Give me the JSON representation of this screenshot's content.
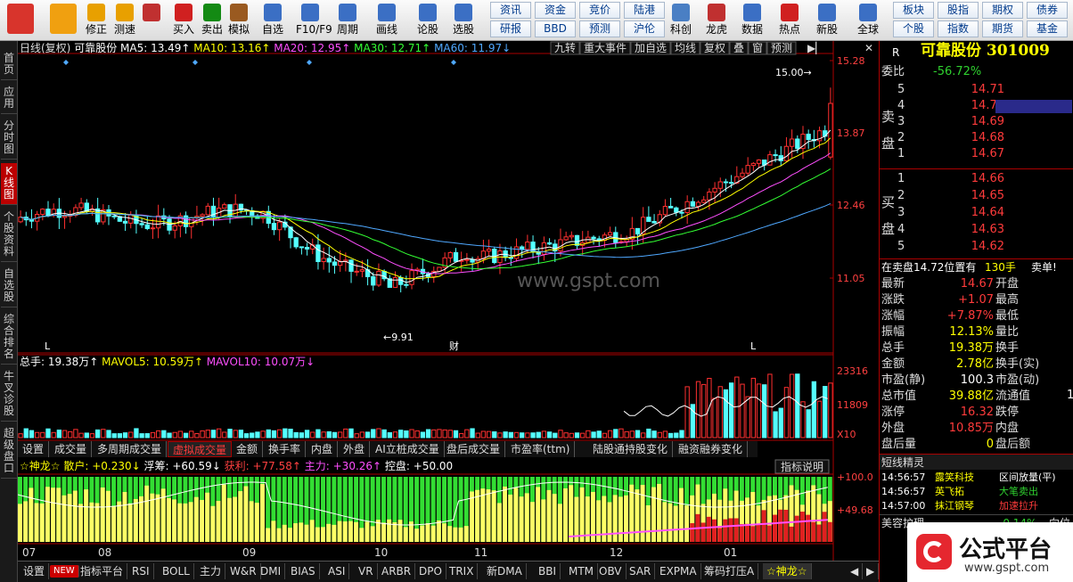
{
  "toolbar": {
    "big": [
      {
        "label": "",
        "icon": "grid-icon",
        "color": "#d8342c"
      },
      {
        "label": "",
        "icon": "back-arrow-icon",
        "color": "#f0a010"
      },
      {
        "label": "修正",
        "icon": "up-arrow-icon",
        "color": "#e8a000"
      },
      {
        "label": "测速",
        "icon": "speed-icon",
        "color": "#e8a000"
      },
      {
        "label": "",
        "icon": "clock-icon",
        "color": "#c03030"
      },
      {
        "label": "买入",
        "icon": "buy-icon",
        "color": "#d02020"
      },
      {
        "label": "卖出",
        "icon": "sell-icon",
        "color": "#138a13"
      },
      {
        "label": "模拟",
        "icon": "hammer-icon",
        "color": "#9a5a20"
      },
      {
        "label": "自选",
        "icon": "star-icon",
        "color": "#3b6fc4"
      },
      {
        "label": "F10/F9",
        "icon": "f10-icon",
        "color": "#3b6fc4"
      },
      {
        "label": "周期",
        "icon": "cycle-icon",
        "color": "#3b6fc4"
      },
      {
        "label": "画线",
        "icon": "pencil-icon",
        "color": "#3b6fc4"
      },
      {
        "label": "论股",
        "icon": "discuss-icon",
        "color": "#3b6fc4"
      },
      {
        "label": "选股",
        "icon": "pick-icon",
        "color": "#3b6fc4"
      },
      {
        "label": "科创",
        "icon": "kechuang-icon",
        "color": "#4a7fc4"
      },
      {
        "label": "龙虎",
        "icon": "dragon-icon",
        "color": "#c03030"
      },
      {
        "label": "数据",
        "icon": "pe-icon",
        "color": "#3b6fc4"
      },
      {
        "label": "热点",
        "icon": "hot-icon",
        "color": "#d02020"
      },
      {
        "label": "新股",
        "icon": "ipo-icon",
        "color": "#3b6fc4"
      },
      {
        "label": "全球",
        "icon": "globe-icon",
        "color": "#3b6fc4"
      }
    ],
    "tags_row1": [
      "资讯",
      "资金",
      "竞价",
      "陆港"
    ],
    "tags_row2": [
      "研报",
      "BBD",
      "预测",
      "沪伦"
    ],
    "tags_right_row1": [
      "板块",
      "股指",
      "期权",
      "债券"
    ],
    "tags_right_row2": [
      "个股",
      "指数",
      "期货",
      "基金"
    ]
  },
  "left_tabs": [
    "首页",
    "应用",
    "分时图",
    "K线图",
    "个股资料",
    "自选股",
    "综合排名",
    "牛叉诊股",
    "超级盘口"
  ],
  "chart": {
    "header_title": "日线(复权)",
    "stock_name": "可靠股份",
    "ma_items": [
      {
        "label": "MA5: 13.49↑",
        "color": "#ffffff"
      },
      {
        "label": "MA10: 13.16↑",
        "color": "#ffff00"
      },
      {
        "label": "MA20: 12.95↑",
        "color": "#ff4fff"
      },
      {
        "label": "MA30: 12.71↑",
        "color": "#33ff33"
      },
      {
        "label": "MA60: 11.97↓",
        "color": "#4fa8ff"
      }
    ],
    "header_buttons": [
      "九转",
      "重大事件",
      "加自选",
      "均线",
      "复权",
      "叠",
      "窗",
      "预测"
    ],
    "price_axis": [
      "15.28",
      "13.87",
      "12.46",
      "11.05"
    ],
    "high_label": "15.00",
    "low_label": "9.91",
    "marker_cai": "财",
    "marker_l": "L",
    "volume_header": [
      {
        "label": "总手: 19.38万↑",
        "color": "#ffffff"
      },
      {
        "label": "MAVOL5: 10.59万↑",
        "color": "#ffff00"
      },
      {
        "label": "MAVOL10: 10.07万↓",
        "color": "#ff4fff"
      }
    ],
    "volume_axis": [
      "23316",
      "11809",
      "X10"
    ],
    "volume_tabs": [
      "设置",
      "成交量",
      "多周期成交量",
      "虚拟成交量",
      "金额",
      "换手率",
      "内盘",
      "外盘",
      "AI立桩成交量",
      "盘后成交量",
      "市盈率(ttm)",
      "陆股通持股变化",
      "融资融券变化"
    ],
    "indicator_header": [
      {
        "label": "☆神龙☆",
        "color": "#ffff00"
      },
      {
        "label": "散户: +0.230↓",
        "color": "#ffff00"
      },
      {
        "label": "浮筹: +60.59↓",
        "color": "#ffffff"
      },
      {
        "label": "获利: +77.58↑",
        "color": "#ff4040"
      },
      {
        "label": "主力: +30.26↑",
        "color": "#ff4fff"
      },
      {
        "label": "控盘: +50.00",
        "color": "#ffffff"
      }
    ],
    "indicator_note": "指标说明",
    "indicator_axis": [
      "+100.0",
      "+49.68"
    ],
    "months": [
      "07",
      "08",
      "09",
      "10",
      "11",
      "12",
      "01"
    ],
    "watermark": "www.gspt.com"
  },
  "right": {
    "code_prefix": "R",
    "title": "可靠股份 301009",
    "weibi_label": "委比",
    "weibi_value": "-56.72%",
    "sell_label": "卖盘",
    "buy_label": "买盘",
    "asks": [
      {
        "n": "5",
        "p": "14.71"
      },
      {
        "n": "4",
        "p": "14.70"
      },
      {
        "n": "3",
        "p": "14.69"
      },
      {
        "n": "2",
        "p": "14.68"
      },
      {
        "n": "1",
        "p": "14.67"
      }
    ],
    "bids": [
      {
        "n": "1",
        "p": "14.66"
      },
      {
        "n": "2",
        "p": "14.65"
      },
      {
        "n": "3",
        "p": "14.64"
      },
      {
        "n": "4",
        "p": "14.63"
      },
      {
        "n": "5",
        "p": "14.62"
      }
    ],
    "notice_text": "在卖盘14.72位置有",
    "notice_qty": "130手",
    "notice_action": "卖单!",
    "quotes": [
      {
        "l": "最新",
        "v": "14.67",
        "c": "red",
        "r": "开盘"
      },
      {
        "l": "涨跌",
        "v": "+1.07",
        "c": "red",
        "r": "最高"
      },
      {
        "l": "涨幅",
        "v": "+7.87%",
        "c": "red",
        "r": "最低"
      },
      {
        "l": "振幅",
        "v": "12.13%",
        "c": "yellow",
        "r": "量比"
      },
      {
        "l": "总手",
        "v": "19.38万",
        "c": "yellow",
        "r": "换手"
      },
      {
        "l": "金额",
        "v": "2.78亿",
        "c": "yellow",
        "r": "换手(实)"
      },
      {
        "l": "市盈(静)",
        "v": "100.3",
        "c": "white",
        "r": "市盈(动)"
      },
      {
        "l": "总市值",
        "v": "39.88亿",
        "c": "yellow",
        "r": "流通值"
      },
      {
        "l": "涨停",
        "v": "16.32",
        "c": "red",
        "r": "跌停"
      },
      {
        "l": "外盘",
        "v": "10.85万",
        "c": "red",
        "r": "内盘"
      },
      {
        "l": "盘后量",
        "v": "0",
        "c": "yellow",
        "r": "盘后额"
      }
    ],
    "quotes_extra": "1",
    "short_title": "短线精灵",
    "shorts": [
      {
        "t": "14:56:57",
        "n": "露笑科技",
        "a": "区间放量(平)",
        "c": "white"
      },
      {
        "t": "14:56:57",
        "n": "英飞拓",
        "a": "大笔卖出",
        "c": "green"
      },
      {
        "t": "14:57:00",
        "n": "抹江钢琴",
        "a": "加速拉升",
        "c": "red"
      }
    ],
    "bottom_name": "美容护理",
    "bottom_pct": "-0.14%",
    "bottom_cut": "向位"
  },
  "logo": {
    "text": "公式平台",
    "url": "www.gspt.com"
  },
  "bottom_tabs": [
    "设置",
    "NEW",
    "指标平台",
    "RSI",
    "BOLL",
    "主力",
    "W&R",
    "DMI",
    "BIAS",
    "ASI",
    "VR",
    "ARBR",
    "DPO",
    "TRIX",
    "新DMA",
    "BBI",
    "MTM",
    "OBV",
    "SAR",
    "EXPMA",
    "筹码打压A",
    "☆神龙☆"
  ]
}
